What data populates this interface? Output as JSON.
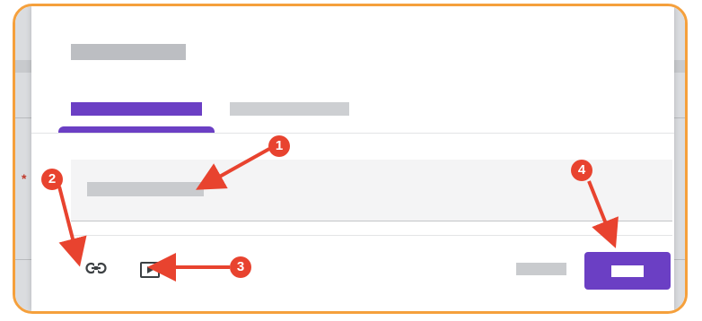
{
  "annotations": {
    "markers": [
      "1",
      "2",
      "3",
      "4"
    ],
    "color": "#e8432f"
  },
  "frame_color": "#f5a03c",
  "dialog": {
    "accent_color": "#6b3fc4",
    "toolbar": {
      "icons": [
        "link-icon",
        "video-icon"
      ]
    }
  }
}
